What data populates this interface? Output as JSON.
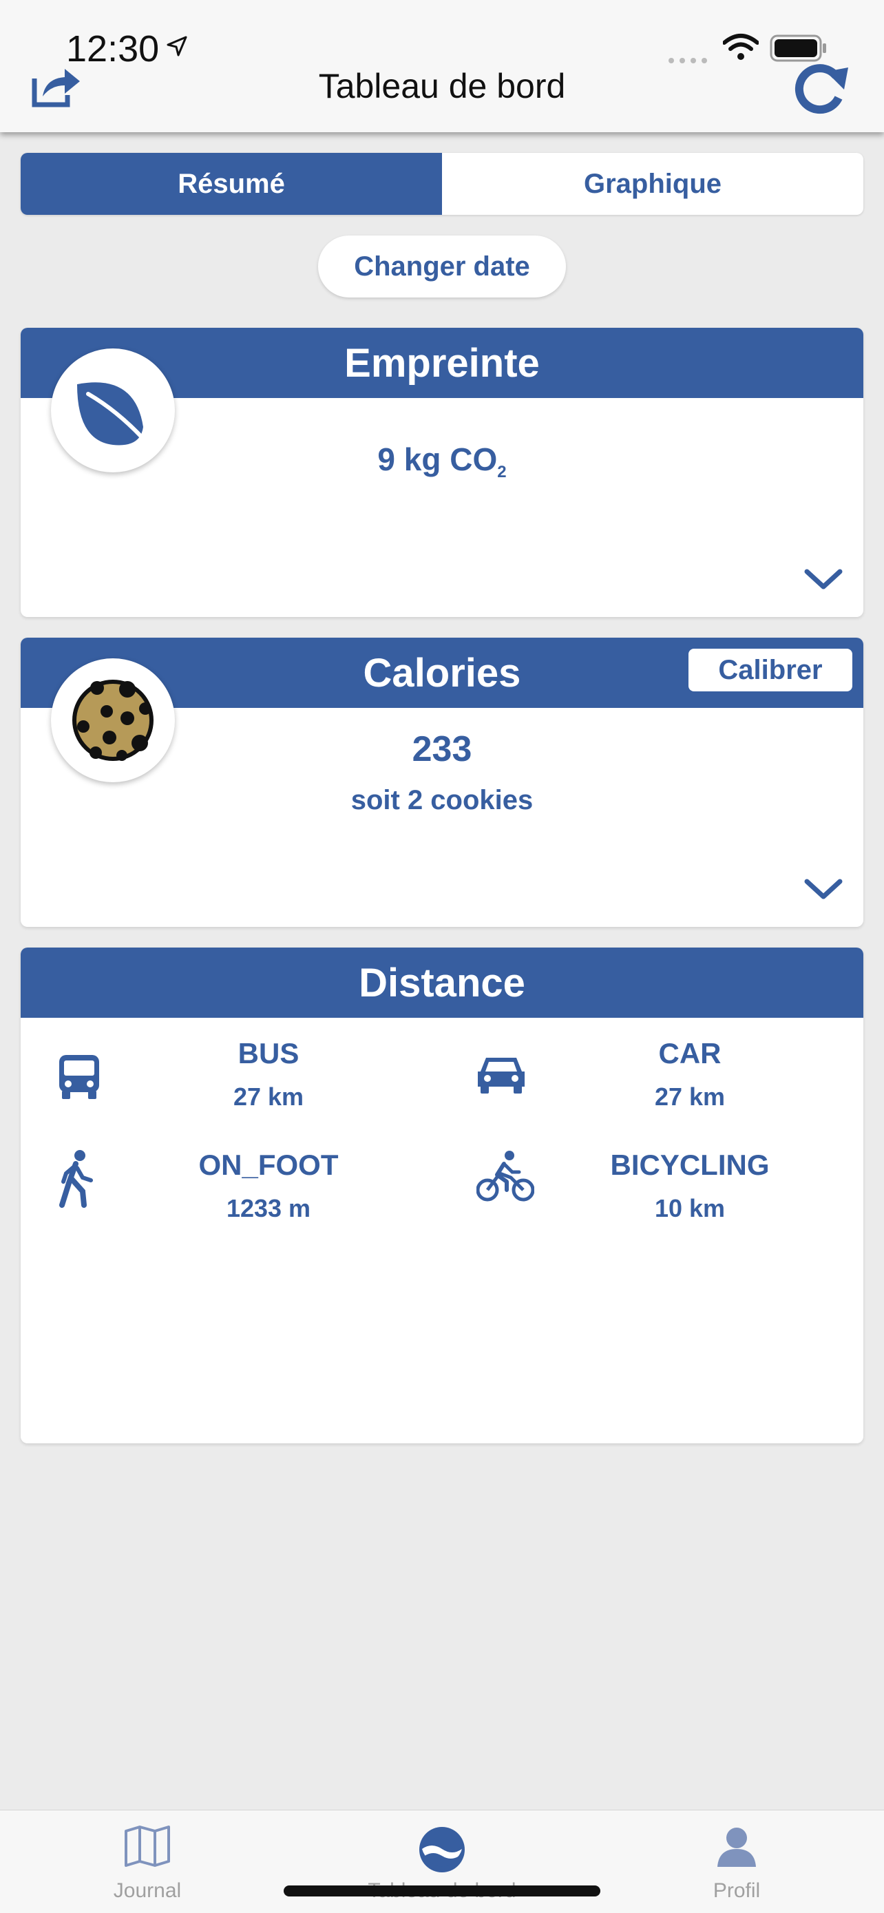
{
  "status_bar": {
    "time": "12:30"
  },
  "nav": {
    "title": "Tableau de bord"
  },
  "segments": {
    "summary": "Résumé",
    "chart": "Graphique"
  },
  "date_button": "Changer date",
  "footprint": {
    "title": "Empreinte",
    "value": "9 kg CO",
    "subscript": "2"
  },
  "calories": {
    "title": "Calories",
    "calibrate": "Calibrer",
    "value": "233",
    "equivalent": "soit 2 cookies"
  },
  "distance": {
    "title": "Distance",
    "modes": [
      {
        "mode": "BUS",
        "value": "27 km",
        "icon": "bus-icon"
      },
      {
        "mode": "CAR",
        "value": "27 km",
        "icon": "car-icon"
      },
      {
        "mode": "ON_FOOT",
        "value": "1233 m",
        "icon": "walking-icon"
      },
      {
        "mode": "BICYCLING",
        "value": "10 km",
        "icon": "bicycle-icon"
      }
    ]
  },
  "tabs": [
    {
      "label": "Journal",
      "icon": "map-icon"
    },
    {
      "label": "Tableau de bord",
      "icon": "dashboard-icon"
    },
    {
      "label": "Profil",
      "icon": "profile-icon"
    }
  ],
  "colors": {
    "accent": "#375ea0",
    "background": "#ebebeb"
  }
}
